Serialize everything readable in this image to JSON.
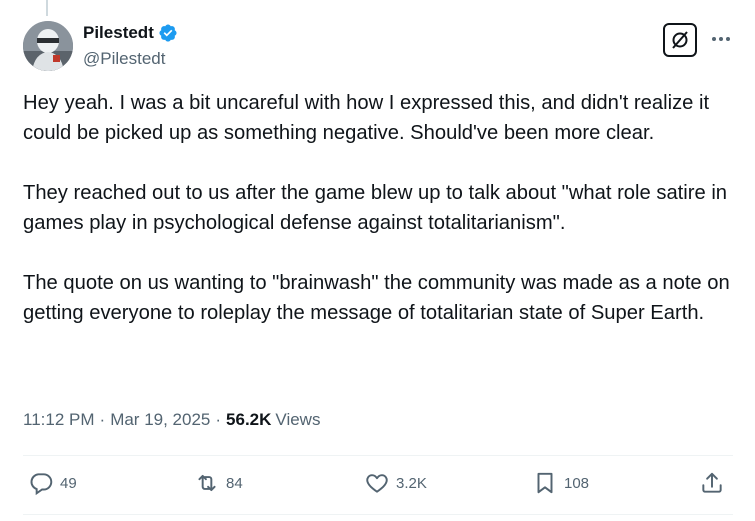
{
  "author": {
    "display_name": "Pilestedt",
    "handle": "@Pilestedt",
    "verified": true
  },
  "icons": {
    "verified": "verified-badge-icon",
    "grok": "grok-icon",
    "more": "more-options-icon",
    "reply": "reply-icon",
    "repost": "repost-icon",
    "like": "like-icon",
    "bookmark": "bookmark-icon",
    "share": "share-icon"
  },
  "tweet": {
    "paragraphs": [
      "Hey yeah. I was a bit uncareful with how I expressed this, and didn't realize it could be picked up as something negative. Should've been more clear.",
      "They reached out to us after the game blew up to talk about \"what role satire in games play in psychological defense against totalitarianism\".",
      "The quote on us wanting to \"brainwash\" the community was made as a note on getting everyone to roleplay the message of totalitarian state of Super Earth."
    ]
  },
  "meta": {
    "time": "11:12 PM",
    "separator": "·",
    "date": "Mar 19, 2025",
    "views_count": "56.2K",
    "views_label": "Views"
  },
  "actions": {
    "replies": "49",
    "reposts": "84",
    "likes": "3.2K",
    "bookmarks": "108"
  },
  "colors": {
    "text": "#0f1419",
    "secondary": "#536471",
    "verified": "#1d9bf0",
    "divider": "#eff3f4"
  }
}
